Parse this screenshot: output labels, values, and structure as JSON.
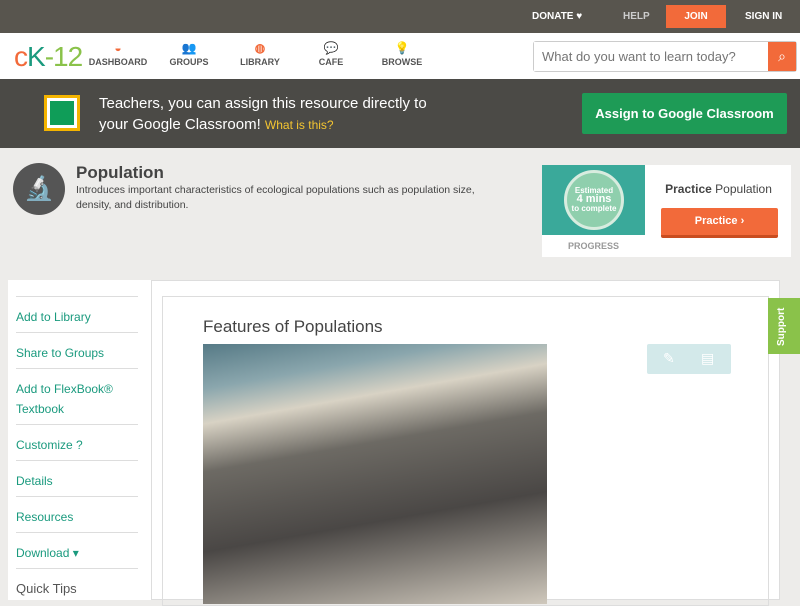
{
  "topbar": {
    "donate": "DONATE ♥",
    "help": "HELP",
    "join": "JOIN",
    "signin": "SIGN IN"
  },
  "logo": {
    "c": "c",
    "k": "K",
    "rest": "-12"
  },
  "nav": [
    {
      "label": "DASHBOARD",
      "icon": "◒"
    },
    {
      "label": "GROUPS",
      "icon": "👥"
    },
    {
      "label": "LIBRARY",
      "icon": "◍"
    },
    {
      "label": "CAFE",
      "icon": "💬"
    },
    {
      "label": "BROWSE",
      "icon": "💡"
    }
  ],
  "search": {
    "placeholder": "What do you want to learn today?",
    "icon": "⌕"
  },
  "banner": {
    "line1": "Teachers, you can assign this resource directly to",
    "line2": "your Google Classroom!",
    "link": "What is this?",
    "button": "Assign to Google Classroom"
  },
  "module": {
    "title": "Population",
    "description": "Introduces important characteristics of ecological populations such as population size, density, and distribution.",
    "icon": "🔬"
  },
  "practice": {
    "est1": "Estimated",
    "est2": "4 mins",
    "est3": "to complete",
    "progress": "PROGRESS",
    "title_bold": "Practice",
    "title_rest": " Population",
    "button": "Practice ›"
  },
  "sidebar": [
    "Add to Library",
    "Share to Groups",
    "Add to FlexBook® Textbook",
    "Customize ?",
    "Details",
    "Resources",
    "Download ▾",
    "Quick Tips"
  ],
  "content": {
    "title": "Features of Populations"
  },
  "support": "Support"
}
